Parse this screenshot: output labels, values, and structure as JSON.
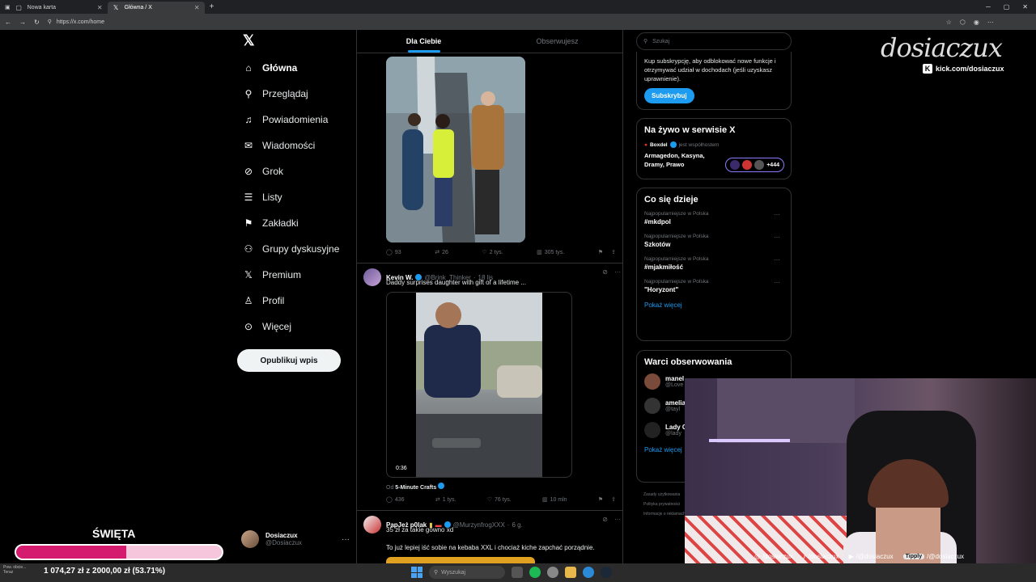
{
  "browser": {
    "tabs": [
      {
        "label": "Nowa karta",
        "active": false
      },
      {
        "label": "Główna / X",
        "active": true
      }
    ],
    "url": "https://x.com/home"
  },
  "nav": {
    "items": [
      {
        "label": "Główna",
        "icon": "home-icon",
        "active": true
      },
      {
        "label": "Przeglądaj",
        "icon": "search-icon"
      },
      {
        "label": "Powiadomienia",
        "icon": "bell-icon"
      },
      {
        "label": "Wiadomości",
        "icon": "mail-icon"
      },
      {
        "label": "Grok",
        "icon": "grok-icon"
      },
      {
        "label": "Listy",
        "icon": "list-icon"
      },
      {
        "label": "Zakładki",
        "icon": "bookmark-icon"
      },
      {
        "label": "Grupy dyskusyjne",
        "icon": "people-icon"
      },
      {
        "label": "Premium",
        "icon": "x-logo-icon"
      },
      {
        "label": "Profil",
        "icon": "person-icon"
      },
      {
        "label": "Więcej",
        "icon": "more-circle-icon"
      }
    ],
    "post_button": "Opublikuj wpis",
    "account": {
      "name": "Dosiaczux",
      "handle": "@Dosiaczux"
    }
  },
  "feed": {
    "tabs": [
      "Dla Ciebie",
      "Obserwujesz"
    ],
    "post1_actions": {
      "replies": "93",
      "reposts": "26",
      "likes": "2 tys.",
      "views": "305 tys."
    },
    "post2": {
      "name": "Kevin W.",
      "handle": "@Brink_Thinker",
      "time": "18 lis",
      "text": "Daddy surprises daughter with gift of a lifetime ...",
      "video_duration": "0:36",
      "from_prefix": "Od",
      "from_source": "5-Minute Crafts",
      "actions": {
        "replies": "436",
        "reposts": "1 tys.",
        "likes": "76 tys.",
        "views": "10 mln"
      }
    },
    "post3": {
      "name": "PapJeż p0lak",
      "handle": "@MurzynfrogXXX",
      "time": "6 g.",
      "text1": "35 zł za takie gówno xd",
      "text2": "To już lepiej iść sobie na kebaba XXL i chociaż kiche zapchać porządnie."
    }
  },
  "sidebar": {
    "search_placeholder": "Szukaj",
    "subscribe": {
      "text": "Kup subskrypcję, aby odblokować nowe funkcje i otrzymywać udział w dochodach (jeśli uzyskasz uprawnienie).",
      "button": "Subskrybuj"
    },
    "live": {
      "title": "Na żywo w serwisie X",
      "host": "Boxdel",
      "host_suffix": "jest współhostem",
      "topic": "Armagedon, Kasyna, Dramy, Prawo",
      "count": "+444"
    },
    "trends": {
      "title": "Co się dzieje",
      "items": [
        {
          "category": "Najpopularniejsze w Polska",
          "name": "#mkdpol"
        },
        {
          "category": "Najpopularniejsze w Polska",
          "name": "Szkotów"
        },
        {
          "category": "Najpopularniejsze w Polska",
          "name": "#mjakmiłość"
        },
        {
          "category": "Najpopularniejsze w Polska",
          "name": "\"Horyzont\""
        }
      ],
      "more": "Pokaż więcej"
    },
    "who_to_follow": {
      "title": "Warci obserwowania",
      "items": [
        {
          "name": "manel",
          "handle": "@Love"
        },
        {
          "name": "amelia",
          "handle": "@tayl"
        },
        {
          "name": "Lady G",
          "handle": "@lady"
        }
      ],
      "more": "Pokaż więcej"
    },
    "footer": [
      "Zasady użytkowania",
      "Polityka prywatności",
      "Informacje o reklamach"
    ]
  },
  "stream": {
    "brand": "dosiaczux",
    "kick": "kick.com/dosiaczux",
    "socials": [
      {
        "icon": "instagram-icon",
        "label": "/dosiaczux"
      },
      {
        "icon": "tiktok-icon",
        "label": "/dosiaczux"
      },
      {
        "icon": "youtube-icon",
        "label": "/@dosiaczux"
      },
      {
        "icon": "tipply-badge",
        "label": "/@dosiaczux",
        "badge": "Tipply"
      }
    ],
    "goal": {
      "title": "ŚWIĘTA",
      "amount_text": "1 074,27 zł z 2000,00 zł (53.71%)",
      "progress": 0.5371
    }
  },
  "taskbar": {
    "search": "Wyszukaj",
    "notification": "Pow. obcie... Teraz"
  }
}
